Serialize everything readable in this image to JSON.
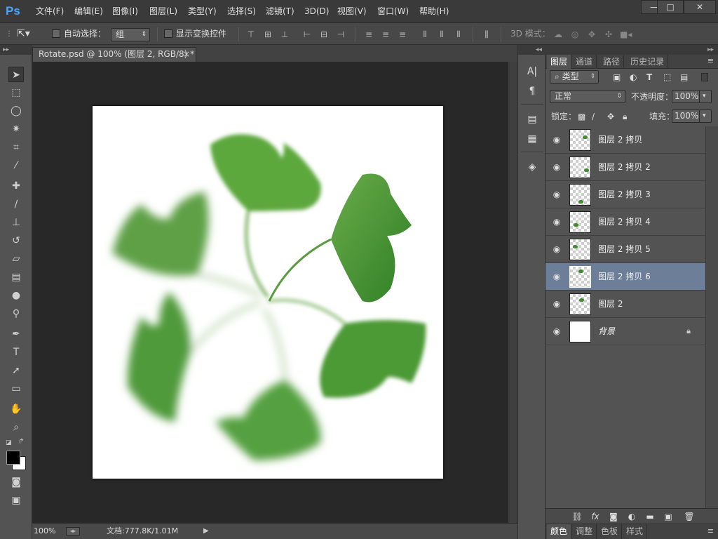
{
  "app": {
    "logo": "Ps"
  },
  "menu": [
    "文件(F)",
    "编辑(E)",
    "图像(I)",
    "图层(L)",
    "类型(Y)",
    "选择(S)",
    "滤镜(T)",
    "3D(D)",
    "视图(V)",
    "窗口(W)",
    "帮助(H)"
  ],
  "window_controls": {
    "minimize": "—",
    "maximize": "□",
    "close": "✕"
  },
  "options": {
    "auto_select_label": "自动选择：",
    "auto_select_value": "组",
    "show_transform_label": "显示变换控件",
    "mode_3d_label": "3D 模式："
  },
  "document": {
    "tab_title": "Rotate.psd @ 100% (图层 2, RGB/8) *",
    "tab_close": "×"
  },
  "status": {
    "zoom": "100%",
    "doc_info": "文档:777.8K/1.01M"
  },
  "layers_panel": {
    "tabs": [
      "图层",
      "通道",
      "路径",
      "历史记录"
    ],
    "active_tab": "图层",
    "filter_label": "类型",
    "blend_mode": "正常",
    "opacity_label": "不透明度：",
    "opacity_value": "100%",
    "lock_label": "锁定：",
    "fill_label": "填充：",
    "fill_value": "100%",
    "layers": [
      {
        "name": "图层 2 拷贝",
        "selected": false
      },
      {
        "name": "图层 2 拷贝 2",
        "selected": false
      },
      {
        "name": "图层 2 拷贝 3",
        "selected": false
      },
      {
        "name": "图层 2 拷贝 4",
        "selected": false
      },
      {
        "name": "图层 2 拷贝 5",
        "selected": false
      },
      {
        "name": "图层 2 拷贝 6",
        "selected": true
      },
      {
        "name": "图层 2",
        "selected": false
      },
      {
        "name": "背景",
        "selected": false,
        "locked": true
      }
    ],
    "bottom_tabs": [
      "颜色",
      "调整",
      "色板",
      "样式"
    ]
  },
  "colors": {
    "selected_layer": "#6d7e98",
    "leaf_green": "#3e8e2e"
  }
}
